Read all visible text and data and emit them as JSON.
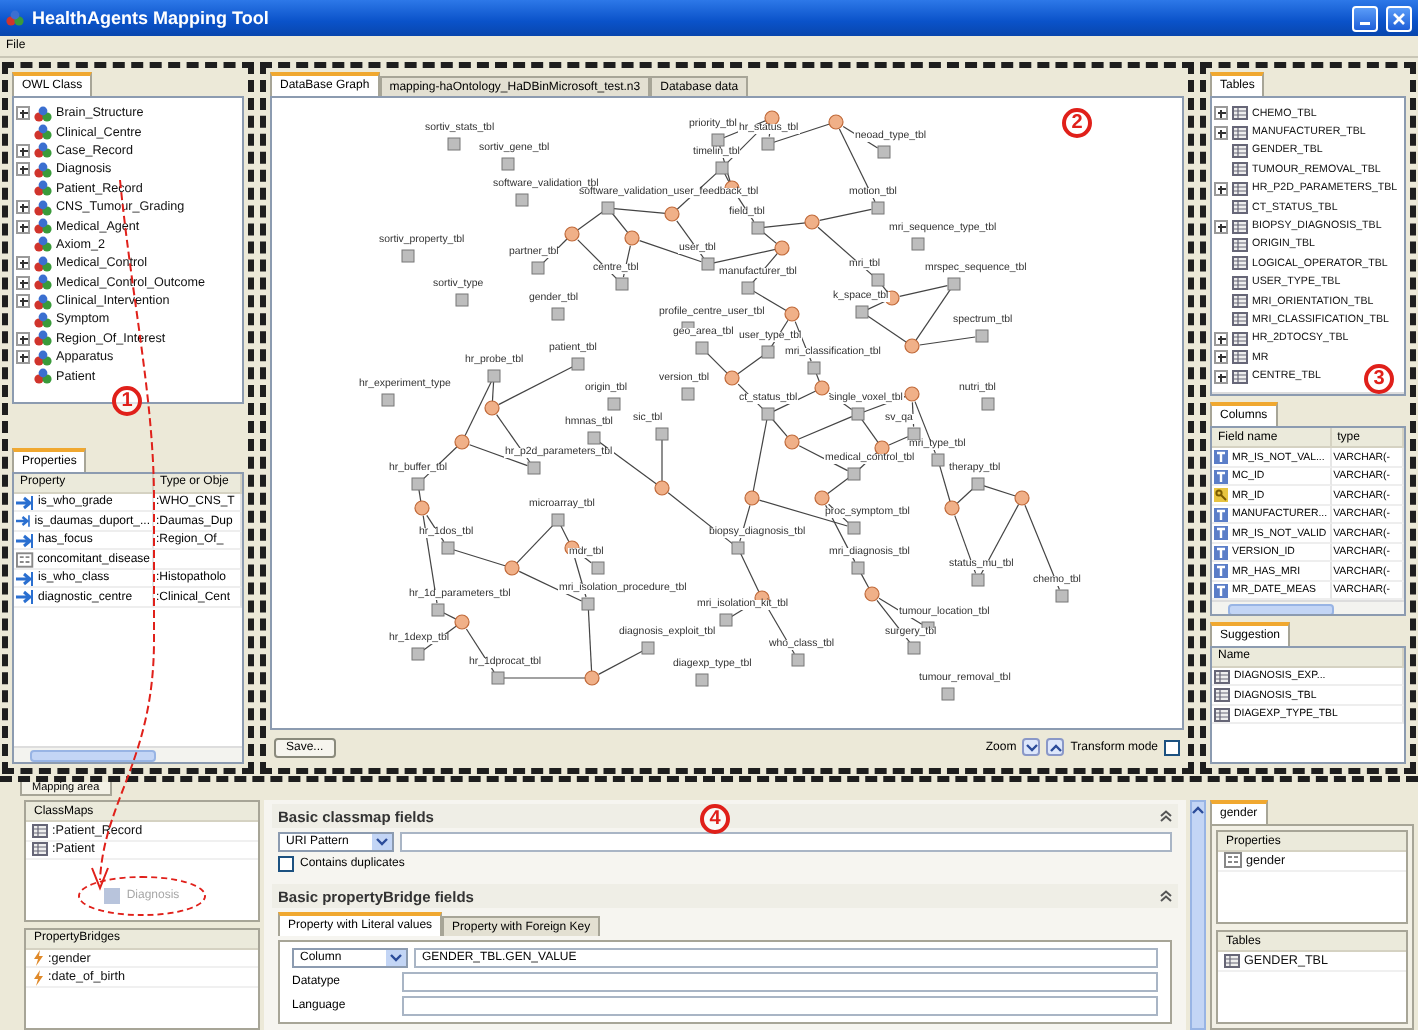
{
  "window": {
    "title": "HealthAgents Mapping Tool"
  },
  "menu": [
    "File"
  ],
  "owl_class_panel": {
    "tab": "OWL Class",
    "classes": [
      {
        "label": "Brain_Structure",
        "expandable": true
      },
      {
        "label": "Clinical_Centre",
        "expandable": false
      },
      {
        "label": "Case_Record",
        "expandable": true
      },
      {
        "label": "Diagnosis",
        "expandable": true
      },
      {
        "label": "Patient_Record",
        "expandable": false
      },
      {
        "label": "CNS_Tumour_Grading",
        "expandable": true
      },
      {
        "label": "Medical_Agent",
        "expandable": true
      },
      {
        "label": "Axiom_2",
        "expandable": false
      },
      {
        "label": "Medical_Control",
        "expandable": true
      },
      {
        "label": "Medical_Control_Outcome",
        "expandable": true
      },
      {
        "label": "Clinical_Intervention",
        "expandable": true
      },
      {
        "label": "Symptom",
        "expandable": false
      },
      {
        "label": "Region_Of_Interest",
        "expandable": true
      },
      {
        "label": "Apparatus",
        "expandable": true
      },
      {
        "label": "Patient",
        "expandable": false
      }
    ]
  },
  "properties_panel": {
    "tab": "Properties",
    "columns": [
      "Property",
      "Type or Obje"
    ],
    "rows": [
      {
        "kind": "object",
        "property": "is_who_grade",
        "type": ":WHO_CNS_T"
      },
      {
        "kind": "object",
        "property": "is_daumas_duport_...",
        "type": ":Daumas_Dup"
      },
      {
        "kind": "object",
        "property": "has_focus",
        "type": ":Region_Of_"
      },
      {
        "kind": "datatype",
        "property": "concomitant_disease"
      },
      {
        "kind": "object",
        "property": "is_who_class",
        "type": ":Histopatholo"
      },
      {
        "kind": "object",
        "property": "diagnostic_centre",
        "type": ":Clinical_Cent"
      }
    ]
  },
  "graph_panel": {
    "tabs": [
      {
        "label": "DataBase Graph",
        "selected": true
      },
      {
        "label": "mapping-haOntology_HaDBinMicrosoft_test.n3",
        "selected": false
      },
      {
        "label": "Database data",
        "selected": false
      }
    ],
    "nodes": [
      {
        "label": "priority_tbl"
      },
      {
        "label": "hr_status_tbl"
      },
      {
        "label": "timelin_tbl"
      },
      {
        "label": "neoad_type_tbl"
      },
      {
        "label": "sortiv_stats_tbl"
      },
      {
        "label": "sortiv_gene_tbl"
      },
      {
        "label": "software_validation_tbl"
      },
      {
        "label": "software_validation_user_feedback_tbl"
      },
      {
        "label": "field_tbl"
      },
      {
        "label": "motion_tbl"
      },
      {
        "label": "sortiv_property_tbl"
      },
      {
        "label": "partner_tbl"
      },
      {
        "label": "user_tbl"
      },
      {
        "label": "manufacturer_tbl"
      },
      {
        "label": "mri_sequence_type_tbl"
      },
      {
        "label": "centre_tbl"
      },
      {
        "label": "mri_tbl"
      },
      {
        "label": "k_space_tbl"
      },
      {
        "label": "mrspec_sequence_tbl"
      },
      {
        "label": "sortiv_type"
      },
      {
        "label": "gender_tbl"
      },
      {
        "label": "profile_centre_user_tbl"
      },
      {
        "label": "spectrum_tbl"
      },
      {
        "label": "geo_area_tbl"
      },
      {
        "label": "user_type_tbl"
      },
      {
        "label": "mri_classification_tbl"
      },
      {
        "label": "patient_tbl"
      },
      {
        "label": "hr_probe_tbl"
      },
      {
        "label": "hr_experiment_type"
      },
      {
        "label": "origin_tbl"
      },
      {
        "label": "version_tbl"
      },
      {
        "label": "ct_status_tbl"
      },
      {
        "label": "single_voxel_tbl"
      },
      {
        "label": "nutri_tbl"
      },
      {
        "label": "hmnas_tbl"
      },
      {
        "label": "sic_tbl"
      },
      {
        "label": "sv_qa"
      },
      {
        "label": "hr_p2d_parameters_tbl"
      },
      {
        "label": "hr_buffer_tbl"
      },
      {
        "label": "medical_control_tbl"
      },
      {
        "label": "mri_type_tbl"
      },
      {
        "label": "therapy_tbl"
      },
      {
        "label": "microarray_tbl"
      },
      {
        "label": "hr_1dos_tbl"
      },
      {
        "label": "proc_symptom_tbl"
      },
      {
        "label": "mdr_tbl"
      },
      {
        "label": "biopsy_diagnosis_tbl"
      },
      {
        "label": "status_mu_tbl"
      },
      {
        "label": "chemo_tbl"
      },
      {
        "label": "mri_diagnosis_tbl"
      },
      {
        "label": "hr_1d_parameters_tbl"
      },
      {
        "label": "mri_isolation_procedure_tbl"
      },
      {
        "label": "mri_isolation_kit_tbl"
      },
      {
        "label": "tumour_location_tbl"
      },
      {
        "label": "surgery_tbl"
      },
      {
        "label": "hr_1dexp_tbl"
      },
      {
        "label": "hr_1dprocat_tbl"
      },
      {
        "label": "diagnosis_exploit_tbl"
      },
      {
        "label": "diagexp_type_tbl"
      },
      {
        "label": "who_class_tbl"
      },
      {
        "label": "tumour_removal_tbl"
      }
    ],
    "save_button": "Save...",
    "zoom_label": "Zoom",
    "transform_mode": {
      "label": "Transform mode",
      "checked": false
    }
  },
  "tables_panel": {
    "tab": "Tables",
    "tables": [
      {
        "label": "CHEMO_TBL",
        "expandable": true
      },
      {
        "label": "MANUFACTURER_TBL",
        "expandable": true
      },
      {
        "label": "GENDER_TBL",
        "expandable": false
      },
      {
        "label": "TUMOUR_REMOVAL_TBL",
        "expandable": false
      },
      {
        "label": "HR_P2D_PARAMETERS_TBL",
        "expandable": true
      },
      {
        "label": "CT_STATUS_TBL",
        "expandable": false
      },
      {
        "label": "BIOPSY_DIAGNOSIS_TBL",
        "expandable": true
      },
      {
        "label": "ORIGIN_TBL",
        "expandable": false
      },
      {
        "label": "LOGICAL_OPERATOR_TBL",
        "expandable": false
      },
      {
        "label": "USER_TYPE_TBL",
        "expandable": false
      },
      {
        "label": "MRI_ORIENTATION_TBL",
        "expandable": false
      },
      {
        "label": "MRI_CLASSIFICATION_TBL",
        "expandable": false
      },
      {
        "label": "HR_2DTOCSY_TBL",
        "expandable": true
      },
      {
        "label": "MR",
        "expandable": true
      },
      {
        "label": "CENTRE_TBL",
        "expandable": true
      }
    ]
  },
  "columns_panel": {
    "tab": "Columns",
    "columns": [
      "Field name",
      "type"
    ],
    "rows": [
      {
        "kind": "field",
        "name": "MR_IS_NOT_VAL...",
        "type": "VARCHAR(-"
      },
      {
        "kind": "field",
        "name": "MC_ID",
        "type": "VARCHAR(-"
      },
      {
        "kind": "key",
        "name": "MR_ID",
        "type": "VARCHAR(-"
      },
      {
        "kind": "field",
        "name": "MANUFACTURER...",
        "type": "VARCHAR(-"
      },
      {
        "kind": "field",
        "name": "MR_IS_NOT_VALID",
        "type": "VARCHAR(-"
      },
      {
        "kind": "field",
        "name": "VERSION_ID",
        "type": "VARCHAR(-"
      },
      {
        "kind": "field",
        "name": "MR_HAS_MRI",
        "type": "VARCHAR(-"
      },
      {
        "kind": "field",
        "name": "MR_DATE_MEAS",
        "type": "VARCHAR(-"
      }
    ]
  },
  "suggestion_panel": {
    "tab": "Suggestion",
    "columns": [
      "Name"
    ],
    "rows": [
      "DIAGNOSIS_EXP...",
      "DIAGNOSIS_TBL",
      "DIAGEXP_TYPE_TBL"
    ]
  },
  "markers": [
    "1",
    "2",
    "3",
    "4"
  ],
  "mapping_area": {
    "tab": "Mapping area",
    "classmaps": {
      "title": "ClassMaps",
      "items": [
        ":Patient_Record",
        ":Patient"
      ],
      "dragged_item": "Diagnosis"
    },
    "property_bridges": {
      "title": "PropertyBridges",
      "items": [
        ":gender",
        ":date_of_birth"
      ]
    },
    "classmap_section": {
      "title": "Basic classmap fields",
      "pattern_select": "URI Pattern",
      "contains_duplicates": {
        "label": "Contains duplicates",
        "checked": false
      }
    },
    "property_bridge_section": {
      "title": "Basic propertyBridge fields",
      "tabs": [
        {
          "label": "Property with Literal values",
          "selected": true
        },
        {
          "label": "Property with Foreign Key",
          "selected": false
        }
      ],
      "column_select": "Column",
      "column_value": "GENDER_TBL.GEN_VALUE",
      "fields": [
        {
          "label": "Datatype"
        },
        {
          "label": "Language"
        }
      ]
    },
    "detail": {
      "tab": "gender",
      "properties": {
        "title": "Properties",
        "rows": [
          "gender"
        ]
      },
      "tables": {
        "title": "Tables",
        "rows": [
          "GENDER_TBL"
        ]
      }
    }
  }
}
